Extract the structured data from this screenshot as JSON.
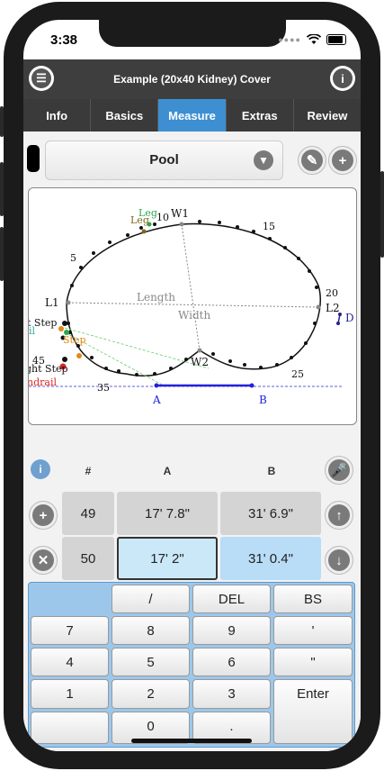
{
  "status": {
    "time": "3:38"
  },
  "header": {
    "title": "Example (20x40 Kidney) Cover",
    "menu_icon": "list-icon",
    "info_icon": "info-icon"
  },
  "tabs": [
    {
      "label": "Info",
      "active": false
    },
    {
      "label": "Basics",
      "active": false
    },
    {
      "label": "Measure",
      "active": true
    },
    {
      "label": "Extras",
      "active": false
    },
    {
      "label": "Review",
      "active": false
    }
  ],
  "selector": {
    "value": "Pool"
  },
  "diagram": {
    "labels": {
      "w1": "W1",
      "w2": "W2",
      "l1": "L1",
      "l2": "L2",
      "length": "Length",
      "width": "Width",
      "a": "A",
      "b": "B",
      "d": "D",
      "n5": "5",
      "n10": "10",
      "n15": "15",
      "n20": "20",
      "n25": "25",
      "n35": "35",
      "n45": "45",
      "leg1": "Leg",
      "leg2": "Leg",
      "step": "Step",
      "step_left": "t Step",
      "step_left2": "ght Step",
      "handrail": "ndrail",
      "rail": "il"
    }
  },
  "measure_table": {
    "headers": {
      "num": "#",
      "a": "A",
      "b": "B"
    },
    "rows": [
      {
        "num": "49",
        "a": "17' 7.8\"",
        "b": "31' 6.9\""
      },
      {
        "num": "50",
        "a": "17' 2\"",
        "b": "31' 0.4\""
      }
    ]
  },
  "keypad": {
    "row1": [
      "",
      "/",
      "DEL",
      "BS"
    ],
    "row2": [
      "7",
      "8",
      "9",
      "'"
    ],
    "row3": [
      "4",
      "5",
      "6",
      "\""
    ],
    "row4": [
      "1",
      "2",
      "3",
      "Enter"
    ],
    "row5": [
      "",
      "0",
      "."
    ]
  },
  "colors": {
    "accent": "#3d8fd1",
    "header": "#3e3e3e",
    "keypad": "#9dc7ea"
  }
}
